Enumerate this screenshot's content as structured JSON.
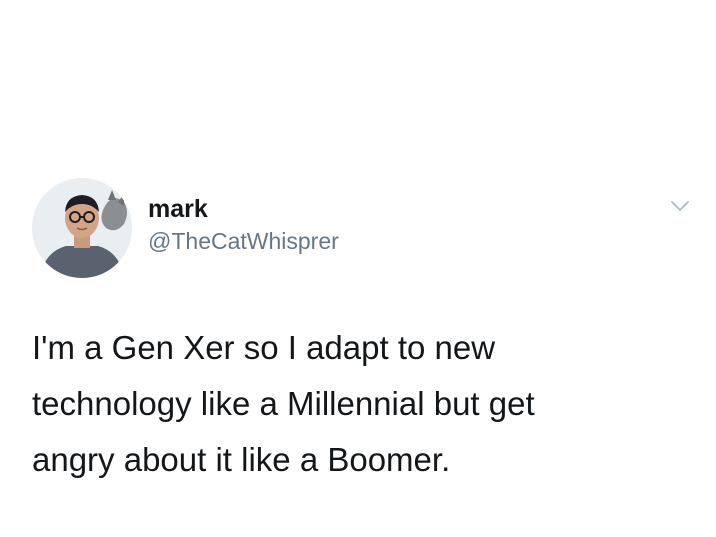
{
  "tweet": {
    "author": {
      "display_name": "mark",
      "handle": "@TheCatWhisprer",
      "avatar_icon": "avatar-photo"
    },
    "menu_icon": "chevron-down-icon",
    "text_lines": [
      "I'm a Gen Xer so I adapt to new",
      "technology like a Millennial but get",
      "angry about it like a Boomer."
    ]
  },
  "colors": {
    "background": "#ffffff",
    "text_primary": "#14171a",
    "text_secondary": "#657786",
    "chevron": "#aab8c2"
  }
}
